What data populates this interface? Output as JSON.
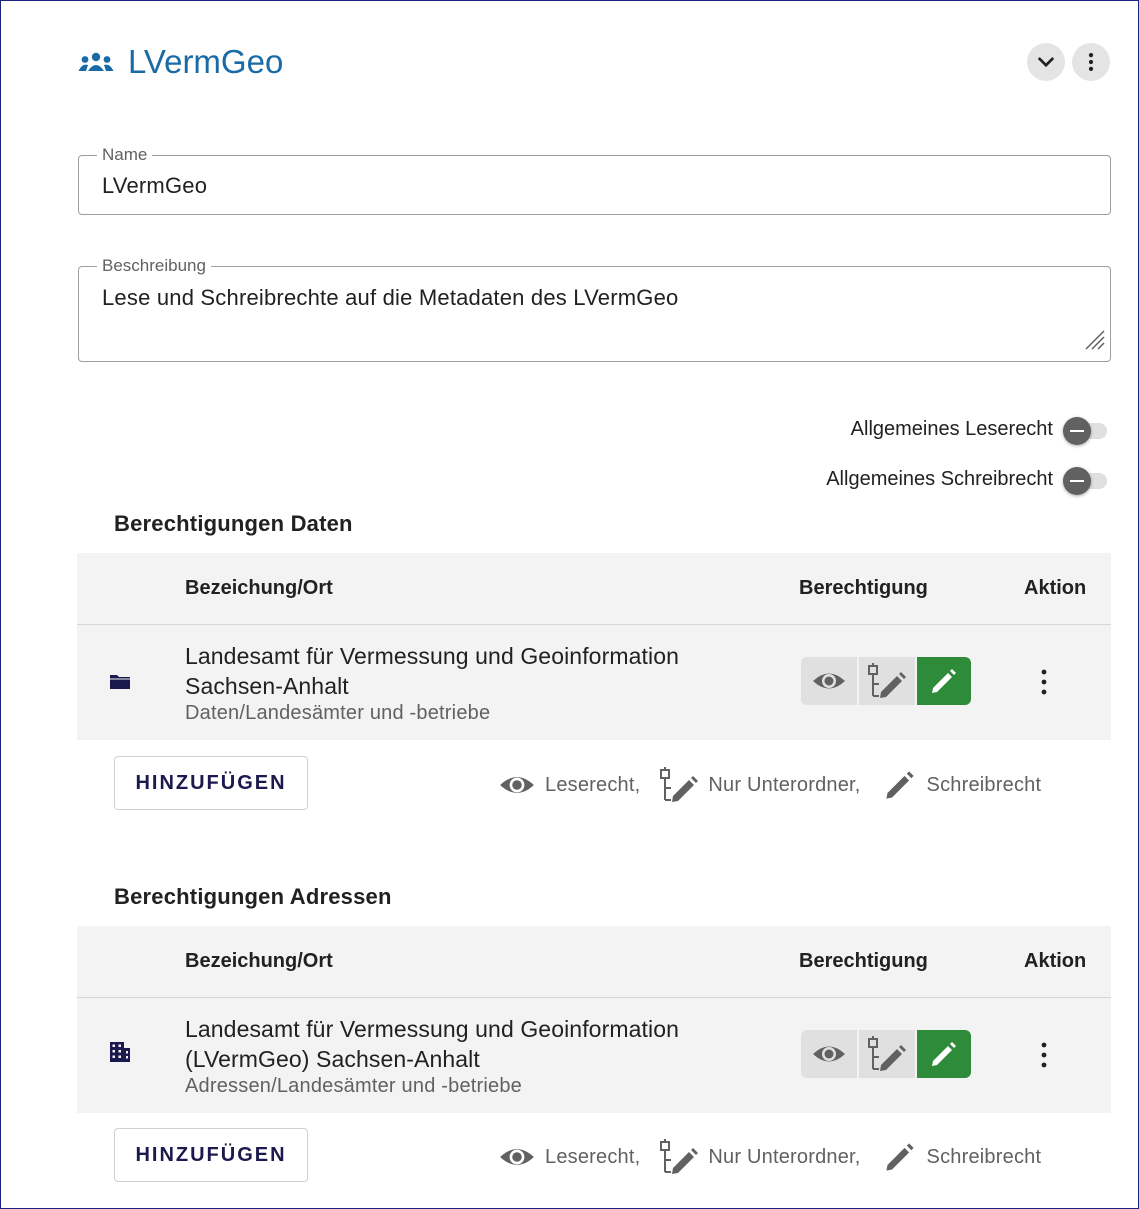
{
  "header": {
    "title": "LVermGeo",
    "group_icon": "group-icon",
    "expand_icon": "chevron-down-icon",
    "menu_icon": "more-vert-icon"
  },
  "form": {
    "name_label": "Name",
    "name_value": "LVermGeo",
    "description_label": "Beschreibung",
    "description_value": "Lese und Schreibrechte auf die Metadaten des LVermGeo"
  },
  "toggles": {
    "read_label": "Allgemeines Leserecht",
    "read_on": false,
    "write_label": "Allgemeines Schreibrecht",
    "write_on": false
  },
  "sections": [
    {
      "title": "Berechtigungen Daten",
      "columns": [
        "Bezeichung/Ort",
        "Berechtigung",
        "Aktion"
      ],
      "row": {
        "icon": "folder-icon",
        "title_line1": "Landesamt für Vermessung und Geoinformation",
        "title_line2": "Sachsen-Anhalt",
        "subtitle": "Daten/Landesämter und -betriebe",
        "selected_permission": "Schreibrecht"
      },
      "add_label": "HINZUFÜGEN"
    },
    {
      "title": "Berechtigungen Adressen",
      "columns": [
        "Bezeichung/Ort",
        "Berechtigung",
        "Aktion"
      ],
      "row": {
        "icon": "building-icon",
        "title_line1": "Landesamt für Vermessung und Geoinformation",
        "title_line2": "(LVermGeo) Sachsen-Anhalt",
        "subtitle": "Adressen/Landesämter und -betriebe",
        "selected_permission": "Schreibrecht"
      },
      "add_label": "HINZUFÜGEN"
    }
  ],
  "legend": {
    "read": "Leserecht,",
    "subfolder": "Nur Unterordner,",
    "write": "Schreibrecht"
  },
  "colors": {
    "accent": "#1a6aa6",
    "active_permission": "#2e8b3a",
    "table_bg": "#f3f3f3",
    "icon_dark": "#1a1a4e"
  }
}
